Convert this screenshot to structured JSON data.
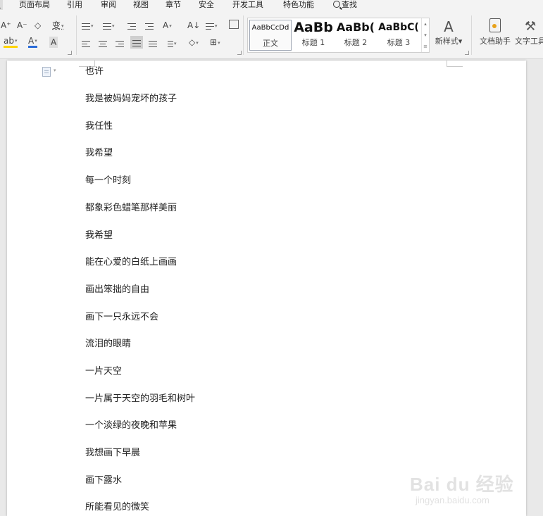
{
  "menu": {
    "items": [
      "页面布局",
      "引用",
      "审阅",
      "视图",
      "章节",
      "安全",
      "开发工具",
      "特色功能"
    ],
    "search_label": "查找"
  },
  "ribbon": {
    "font_grow": "A⁺",
    "font_shrink": "A⁻",
    "clear_format": "◇",
    "phonetic": "变",
    "highlight": "ab",
    "font_color": "A",
    "char_shade": "A",
    "sort": "A↓",
    "chinese_layout": "A",
    "styles": [
      {
        "preview": "AaBbCcDd",
        "name": "正文"
      },
      {
        "preview": "AaBb",
        "name": "标题 1"
      },
      {
        "preview": "AaBb(",
        "name": "标题 2"
      },
      {
        "preview": "AaBbC(",
        "name": "标题 3"
      }
    ],
    "new_style_label": "新样式",
    "doc_assistant_label": "文档助手",
    "text_tools_label": "文字工具"
  },
  "document": {
    "lines": [
      "也许",
      "我是被妈妈宠坏的孩子",
      "我任性",
      "我希望",
      "每一个时刻",
      "都象彩色蜡笔那样美丽",
      "我希望",
      "能在心爱的白纸上画画",
      "画出笨拙的自由",
      "画下一只永远不会",
      "流泪的眼睛",
      "一片天空",
      "一片属于天空的羽毛和树叶",
      "一个淡绿的夜晚和苹果",
      "我想画下早晨",
      "画下露水",
      "所能看见的微笑"
    ]
  },
  "watermark": {
    "brand": "Bai du 经验",
    "url": "jingyan.baidu.com"
  },
  "colors": {
    "ribbon_bg": "#f3f3f3",
    "page_bg": "#ffffff",
    "workspace_bg": "#e9e9e9",
    "font_color_underline": "#2b6cd8",
    "highlight_underline": "#ffd400",
    "assistant_icon": "#e8a21a"
  }
}
